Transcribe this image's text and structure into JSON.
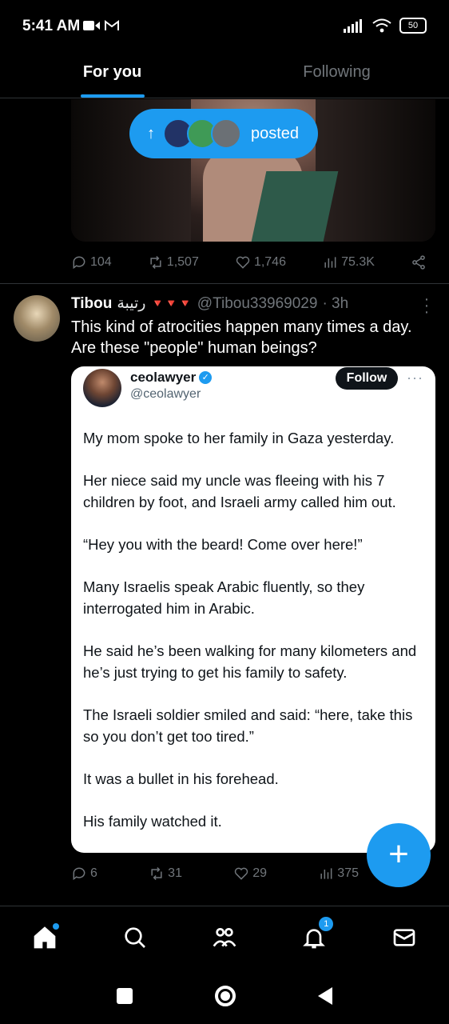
{
  "status_bar": {
    "time": "5:41 AM",
    "battery": "50"
  },
  "tabs": [
    {
      "label": "For you",
      "active": true
    },
    {
      "label": "Following",
      "active": false
    }
  ],
  "posted_pill": {
    "label": "posted"
  },
  "prev_post_actions": {
    "replies": "104",
    "reposts": "1,507",
    "likes": "1,746",
    "views": "75.3K"
  },
  "tweet": {
    "name": "Tibou",
    "arabic_name": "رتيبة",
    "flags": "🔻🔻🔻",
    "handle": "@Tibou33969029",
    "time": "· 3h",
    "text": "This kind of atrocities happen many times a day. Are these \"people\" human beings?",
    "actions": {
      "replies": "6",
      "reposts": "31",
      "likes": "29",
      "views": "375"
    }
  },
  "embedded": {
    "name": "ceolawyer",
    "handle": "@ceolawyer",
    "follow_label": "Follow",
    "more": "···",
    "paragraphs": [
      "My mom spoke to her family in Gaza yesterday.",
      "Her niece said my uncle was fleeing with his 7 children by foot, and Israeli army called him out.",
      "“Hey you with the beard! Come over here!”",
      "Many Israelis speak Arabic fluently, so they interrogated him in Arabic.",
      "He said he’s been walking for many kilometers and he’s just trying to get his family to safety.",
      "The Israeli soldier smiled and said: “here, take this so you don’t get too tired.”",
      "It was a bullet in his forehead.",
      "His family watched it."
    ]
  },
  "fab": {
    "label": "+"
  },
  "nav": {
    "notification_badge": "1"
  },
  "colors": {
    "accent": "#1d9bf0",
    "background": "#000000",
    "muted": "#71767b"
  }
}
